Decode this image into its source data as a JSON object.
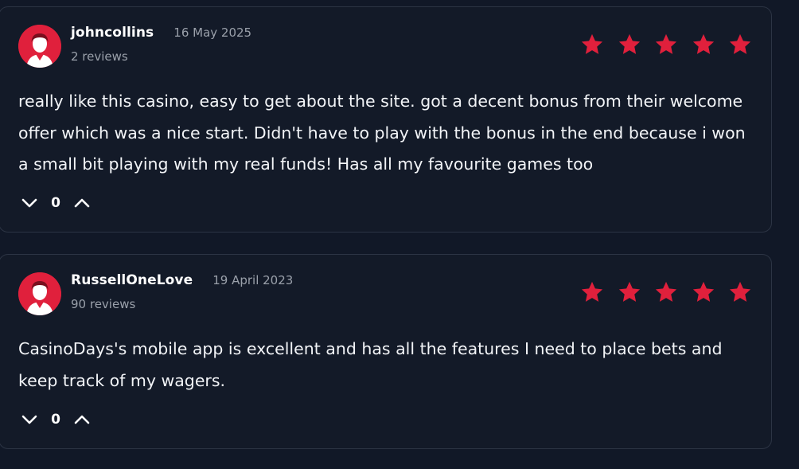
{
  "colors": {
    "background": "#111827",
    "card": "#131a28",
    "accent": "#e0203c",
    "muted_text": "#9aa0aa"
  },
  "reviews": [
    {
      "username": "johncollins",
      "date": "16 May 2025",
      "review_count": "2 reviews",
      "rating": 5,
      "text": "really like this casino, easy to get about the site. got a decent bonus from their welcome offer which was a nice start. Didn't have to play with the bonus in the end because i won a small bit playing with my real funds! Has all my favourite games too",
      "votes": "0",
      "icons": {
        "avatar": "user-avatar-icon",
        "downvote": "chevron-down-icon",
        "upvote": "chevron-up-icon",
        "star": "star-icon"
      }
    },
    {
      "username": "RussellOneLove",
      "date": "19 April 2023",
      "review_count": "90 reviews",
      "rating": 5,
      "text": "CasinoDays's mobile app is excellent and has all the features I need to place bets and keep track of my wagers.",
      "votes": "0",
      "icons": {
        "avatar": "user-avatar-icon",
        "downvote": "chevron-down-icon",
        "upvote": "chevron-up-icon",
        "star": "star-icon"
      }
    }
  ]
}
